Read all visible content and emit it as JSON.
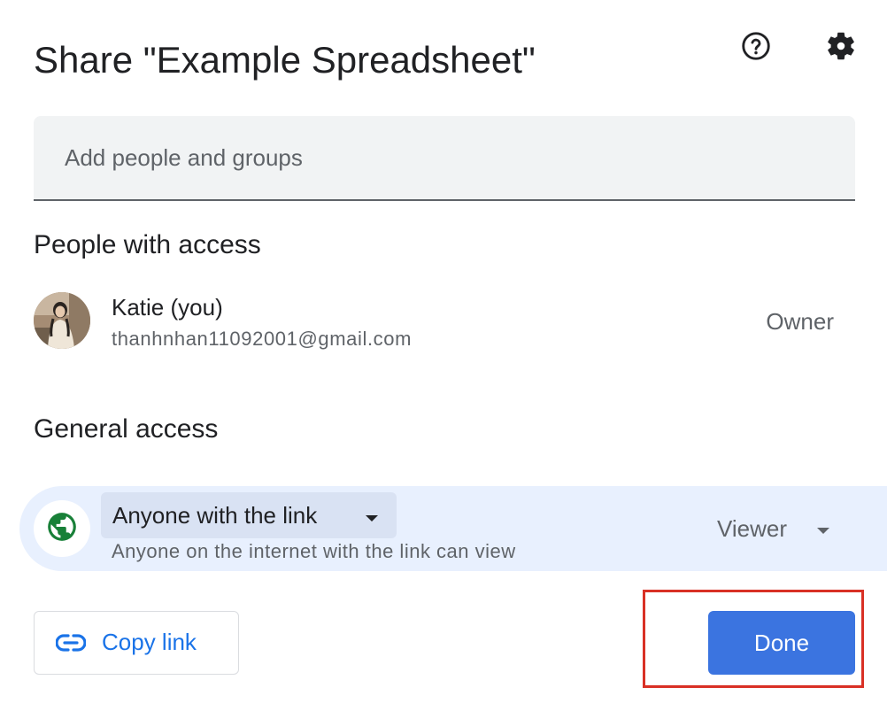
{
  "dialog": {
    "title": "Share \"Example Spreadsheet\"",
    "help_icon": "help-circle-icon",
    "settings_icon": "gear-icon"
  },
  "add_people": {
    "placeholder": "Add people and groups",
    "value": ""
  },
  "people_with_access": {
    "heading": "People with access",
    "people": [
      {
        "name": "Katie (you)",
        "email": "thanhnhan11092001@gmail.com",
        "role": "Owner"
      }
    ]
  },
  "general_access": {
    "heading": "General access",
    "icon": "globe-icon",
    "link_scope": "Anyone with the link",
    "description": "Anyone on the internet with the link can view",
    "role": "Viewer"
  },
  "footer": {
    "copy_link_label": "Copy link",
    "copy_link_icon": "link-icon",
    "done_label": "Done"
  },
  "colors": {
    "accent": "#1a73e8",
    "done_button": "#3b74e0",
    "access_panel": "#e8f0fe",
    "globe": "#188038",
    "highlight_box": "#d93025"
  }
}
